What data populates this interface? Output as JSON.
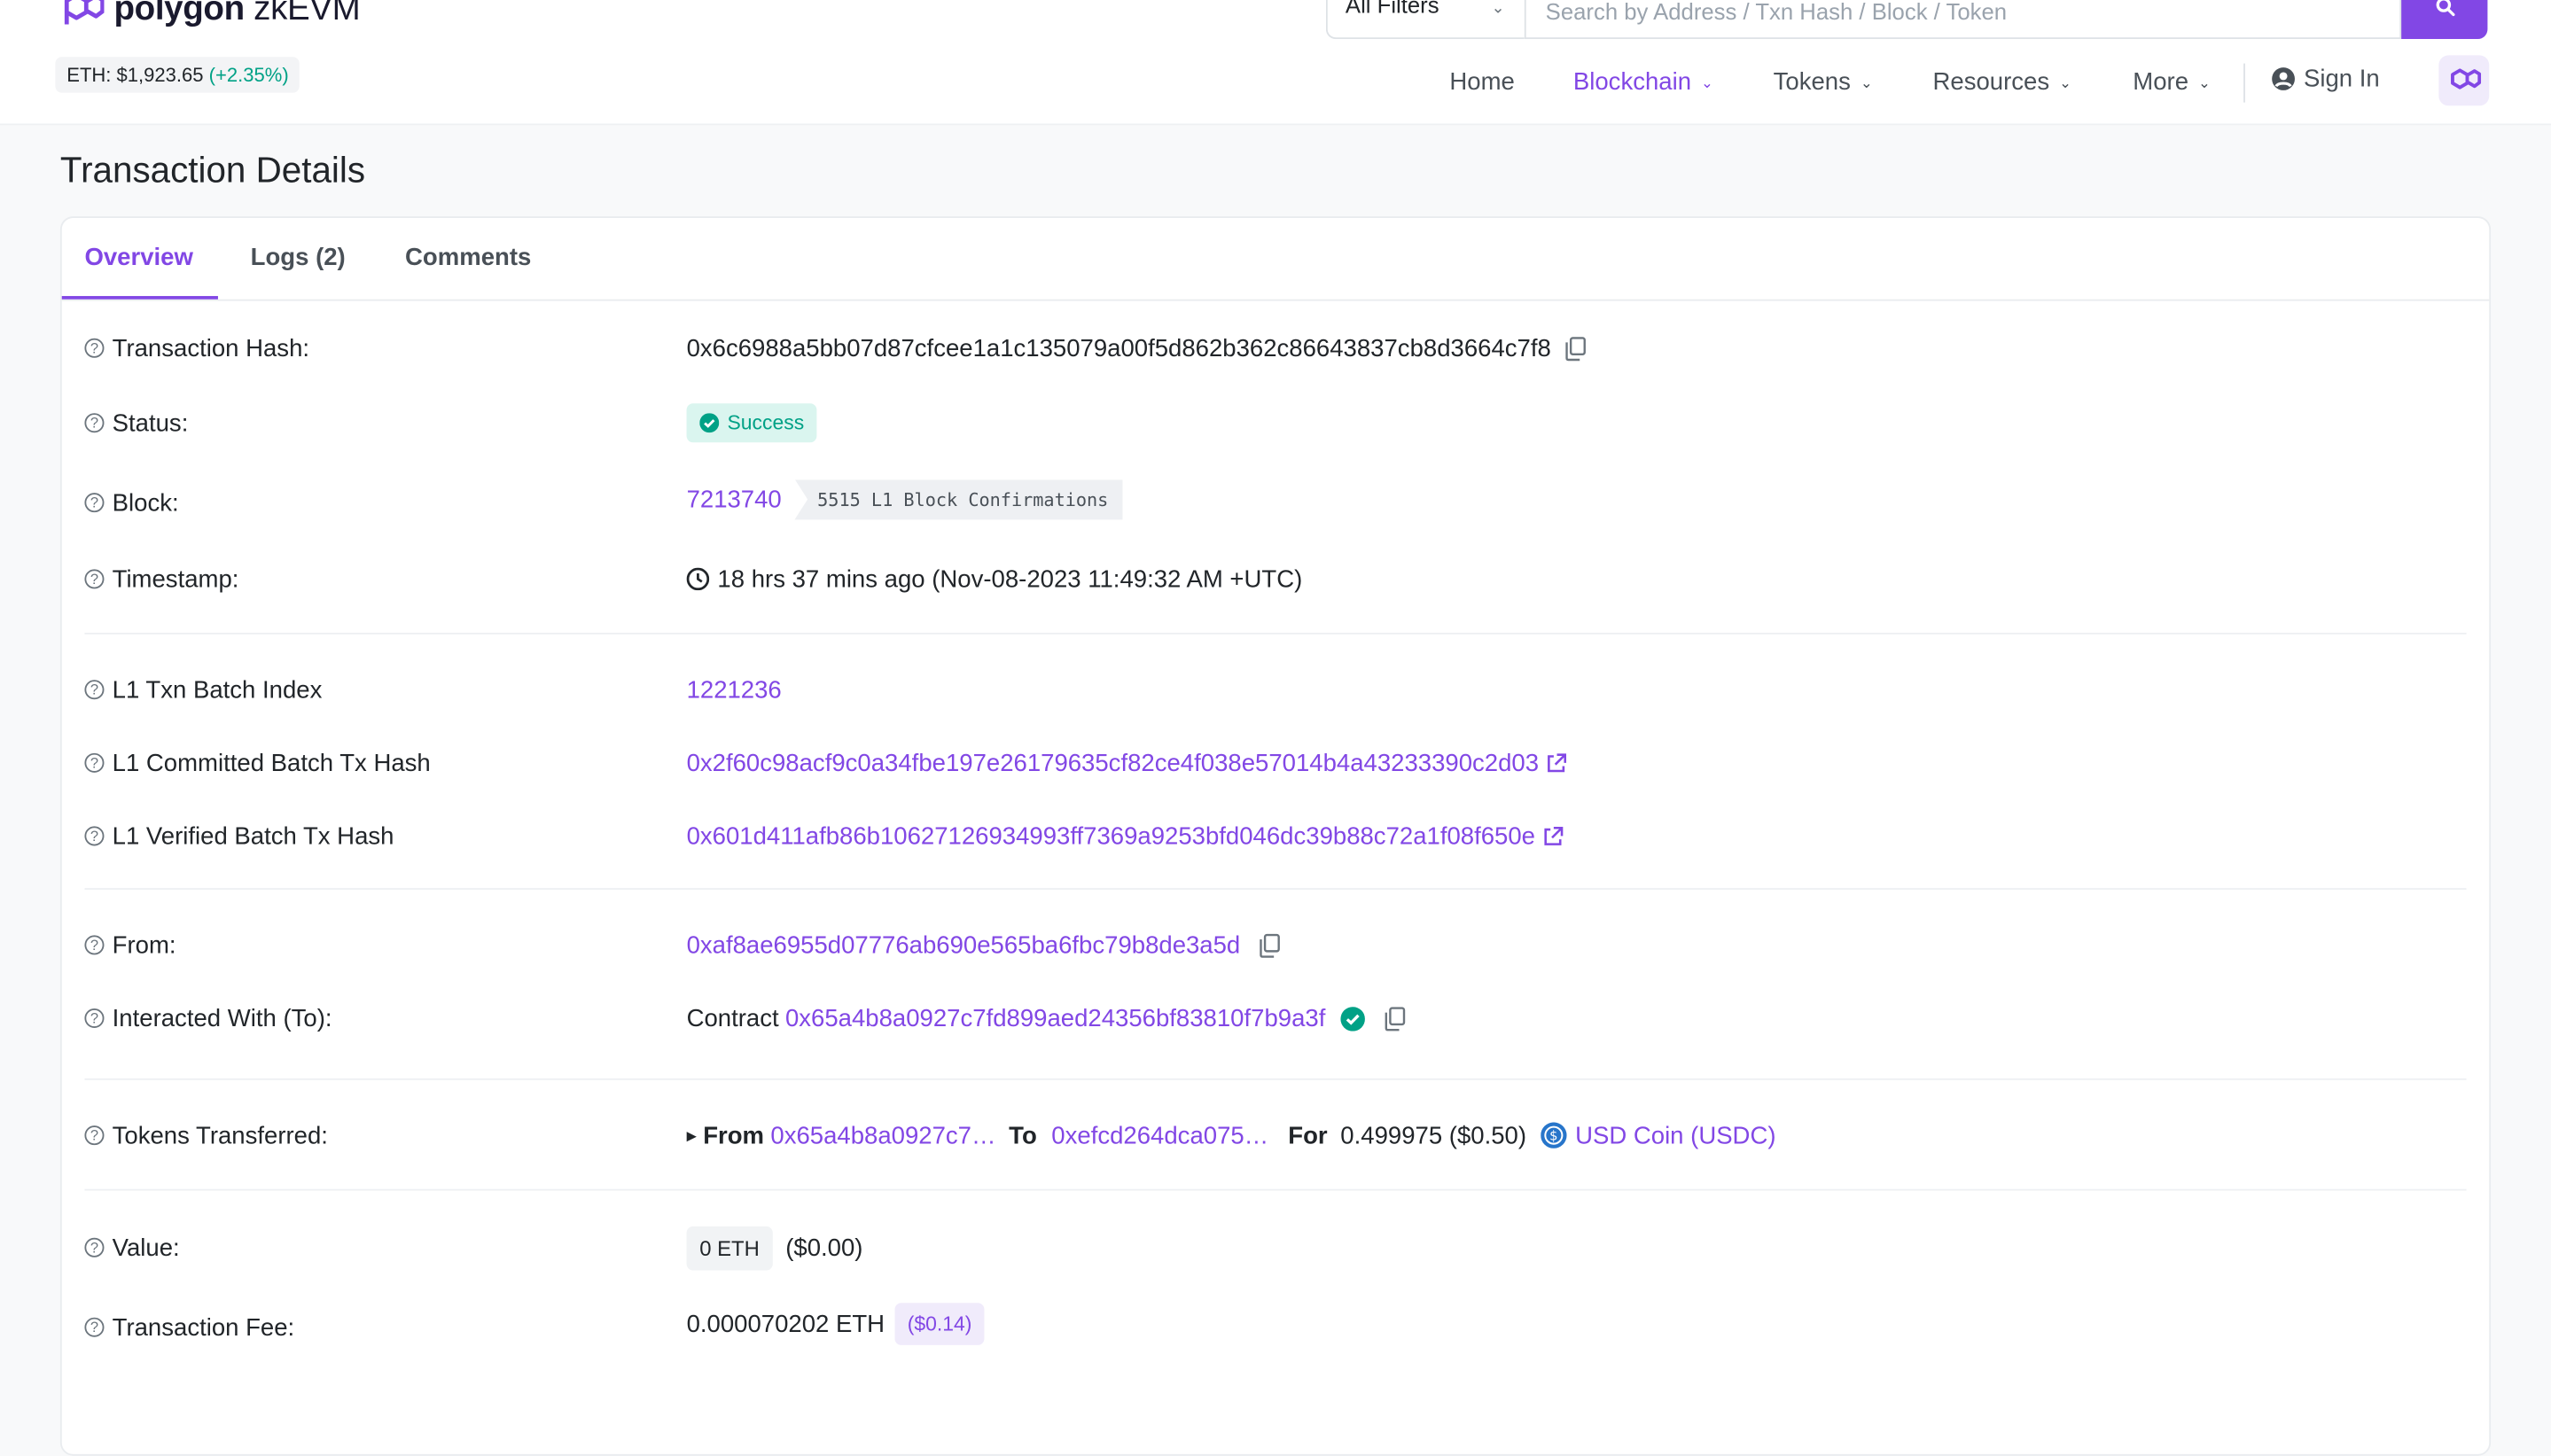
{
  "header": {
    "logo_brand": "polygon",
    "logo_product": "zkEVM",
    "price_label": "ETH: $1,923.65",
    "price_change": "(+2.35%)",
    "filter_label": "All Filters",
    "search_placeholder": "Search by Address / Txn Hash / Block / Token",
    "nav": {
      "home": "Home",
      "blockchain": "Blockchain",
      "tokens": "Tokens",
      "resources": "Resources",
      "more": "More",
      "sign_in": "Sign In"
    }
  },
  "page_title": "Transaction Details",
  "tabs": {
    "overview": "Overview",
    "logs": "Logs (2)",
    "comments": "Comments"
  },
  "details": {
    "tx_hash": {
      "label": "Transaction Hash:",
      "value": "0x6c6988a5bb07d87cfcee1a1c135079a00f5d862b362c86643837cb8d3664c7f8"
    },
    "status": {
      "label": "Status:",
      "value": "Success"
    },
    "block": {
      "label": "Block:",
      "value": "7213740",
      "confirmations": "5515 L1 Block Confirmations"
    },
    "timestamp": {
      "label": "Timestamp:",
      "value": "18 hrs 37 mins ago (Nov-08-2023 11:49:32 AM +UTC)"
    },
    "l1_batch_index": {
      "label": "L1 Txn Batch Index",
      "value": "1221236"
    },
    "l1_committed": {
      "label": "L1 Committed Batch Tx Hash",
      "value": "0x2f60c98acf9c0a34fbe197e26179635cf82ce4f038e57014b4a43233390c2d03"
    },
    "l1_verified": {
      "label": "L1 Verified Batch Tx Hash",
      "value": "0x601d411afb86b10627126934993ff7369a9253bfd046dc39b88c72a1f08f650e"
    },
    "from": {
      "label": "From:",
      "value": "0xaf8ae6955d07776ab690e565ba6fbc79b8de3a5d"
    },
    "to": {
      "label": "Interacted With (To):",
      "prefix": "Contract",
      "value": "0x65a4b8a0927c7fd899aed24356bf83810f7b9a3f"
    },
    "tokens": {
      "label": "Tokens Transferred:",
      "from_label": "From",
      "from_value": "0x65a4b8a0927c7…",
      "to_label": "To",
      "to_value": "0xefcd264dca075…",
      "for_label": "For",
      "amount": "0.499975 ($0.50)",
      "token": "USD Coin (USDC)"
    },
    "value": {
      "label": "Value:",
      "eth": "0 ETH",
      "usd": "($0.00)"
    },
    "fee": {
      "label": "Transaction Fee:",
      "eth": "0.000070202 ETH",
      "usd": "($0.14)"
    }
  },
  "colors": {
    "accent": "#8247e5",
    "success": "#00a186"
  }
}
